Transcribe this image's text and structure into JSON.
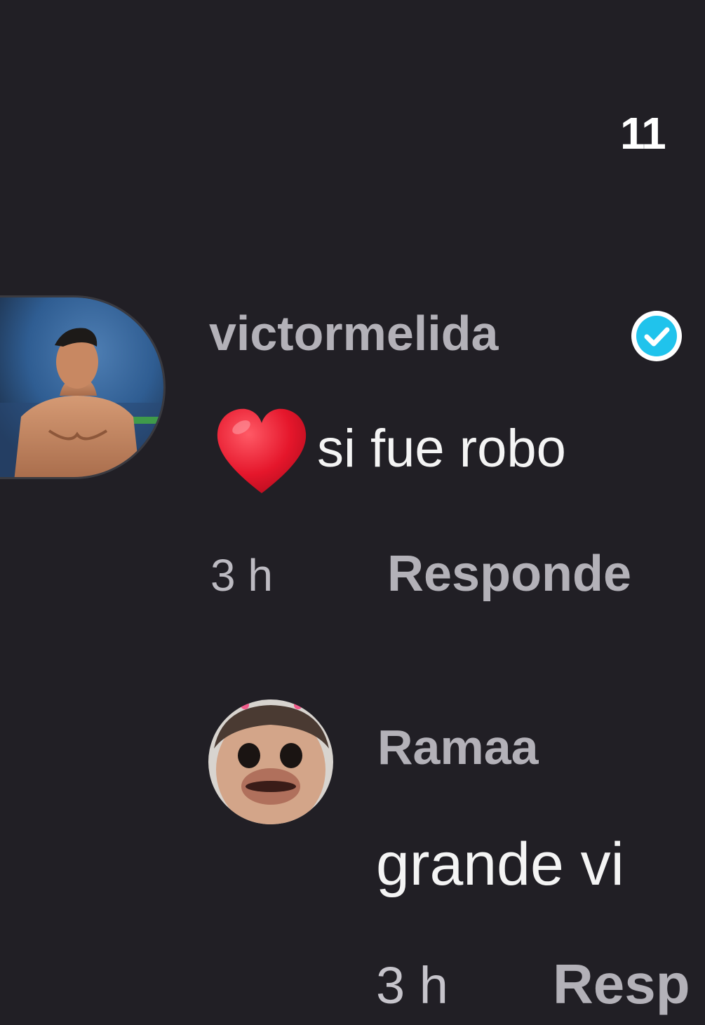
{
  "header": {
    "count_text": "11"
  },
  "comments": [
    {
      "username": "victormelida",
      "verified": true,
      "emoji": "heart",
      "text": "si fue robo",
      "time": "3 h",
      "reply_label": "Responde"
    },
    {
      "username": "Ramaa",
      "verified": false,
      "text": "grande vi",
      "time": "3 h",
      "reply_label": "Resp"
    }
  ],
  "colors": {
    "background": "#211f25",
    "username": "#b3b1b8",
    "comment_text": "#f4f4f4",
    "verified_badge": "#20c3ec",
    "heart": "#e5162b"
  },
  "icons": {
    "verified": "verified-badge-icon",
    "heart": "red-heart-emoji-icon"
  }
}
